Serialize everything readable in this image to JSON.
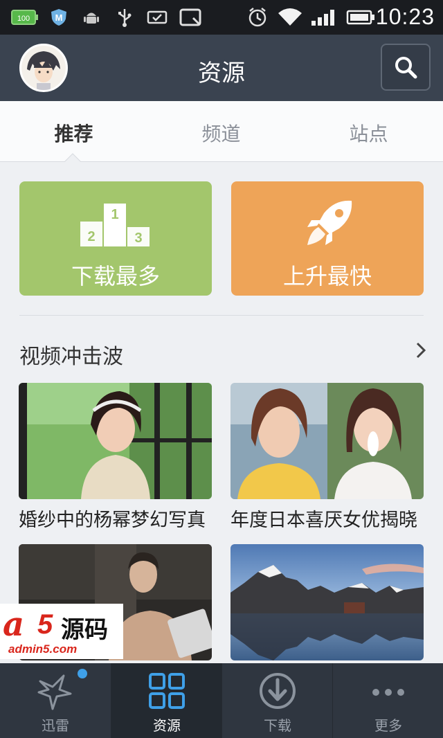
{
  "status_bar": {
    "time": "10:23",
    "icons": [
      "battery-100-icon",
      "shield-icon",
      "android-icon",
      "usb-icon",
      "card-icon",
      "screenshot-icon",
      "alarm-icon",
      "wifi-icon",
      "signal-icon",
      "battery-icon"
    ],
    "battery_small_text": "100"
  },
  "header": {
    "title": "资源",
    "avatar": "user-avatar",
    "search_icon": "search-icon"
  },
  "tabs": [
    {
      "label": "推荐",
      "active": true
    },
    {
      "label": "频道",
      "active": false
    },
    {
      "label": "站点",
      "active": false
    }
  ],
  "tiles": [
    {
      "label": "下载最多",
      "color": "#a3c66c",
      "icon": "podium-icon",
      "podium": [
        "2",
        "1",
        "3"
      ]
    },
    {
      "label": "上升最快",
      "color": "#eea458",
      "icon": "rocket-icon"
    }
  ],
  "section": {
    "title": "视频冲击波",
    "more_icon": "chevron-right-icon"
  },
  "videos": [
    {
      "caption": "婚纱中的杨幂梦幻写真"
    },
    {
      "caption": "年度日本喜厌女优揭晓"
    },
    {
      "caption": ""
    },
    {
      "caption": ""
    }
  ],
  "watermark": {
    "brand_a": "a",
    "brand_5": "5",
    "brand_cn": "源码",
    "url": "admin5.com"
  },
  "bottom_nav": [
    {
      "label": "迅雷",
      "icon": "xunlei-bird-icon",
      "active": false,
      "badge": true
    },
    {
      "label": "资源",
      "icon": "grid-icon",
      "active": true,
      "badge": false
    },
    {
      "label": "下载",
      "icon": "download-icon",
      "active": false,
      "badge": false
    },
    {
      "label": "更多",
      "icon": "more-dots-icon",
      "active": false,
      "badge": false
    }
  ],
  "colors": {
    "header_bg": "#3a4350",
    "accent_blue": "#3fa0e8",
    "tile_green": "#a3c66c",
    "tile_orange": "#eea458"
  }
}
